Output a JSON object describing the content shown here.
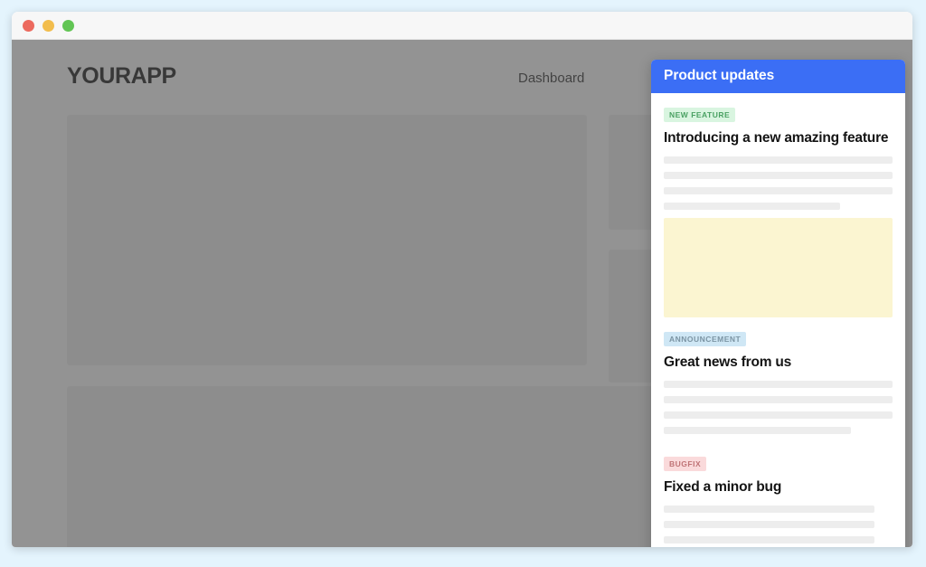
{
  "window": {
    "traffic_lights": [
      {
        "name": "close",
        "color": "#ec6a5e"
      },
      {
        "name": "minimize",
        "color": "#f2bd4d"
      },
      {
        "name": "maximize",
        "color": "#62c554"
      }
    ]
  },
  "app": {
    "brand": "YOURAPP",
    "nav": [
      "Dashboard"
    ],
    "placeholder_blocks": [
      "hero",
      "side-top",
      "side-bottom",
      "wide"
    ]
  },
  "panel": {
    "header_title": "Product updates",
    "header_color": "#3b6ef5",
    "articles": [
      {
        "badge": "NEW FEATURE",
        "badge_bg": "#d9f5e0",
        "badge_color": "#4aa163",
        "title": "Introducing a new amazing feature",
        "skeleton_widths": [
          "100%",
          "100%",
          "100%",
          "77%"
        ],
        "media": {
          "type": "image-placeholder",
          "color": "#fbf5d1"
        }
      },
      {
        "badge": "ANNOUNCEMENT",
        "badge_bg": "#cfe7f5",
        "badge_color": "#7b94a3",
        "title": "Great news from us",
        "skeleton_widths": [
          "100%",
          "100%",
          "100%",
          "82%"
        ],
        "media": null
      },
      {
        "badge": "BUGFIX",
        "badge_bg": "#fadadb",
        "badge_color": "#c07477",
        "title": "Fixed a minor bug",
        "skeleton_widths": [
          "92%",
          "92%",
          "92%",
          "72%"
        ],
        "media": null
      }
    ]
  },
  "colors": {
    "page_background": "#e4f4fd",
    "dim_overlay": "rgba(80,80,80,0.62)",
    "titlebar": "#f7f7f7",
    "skeleton": "#ededed"
  }
}
